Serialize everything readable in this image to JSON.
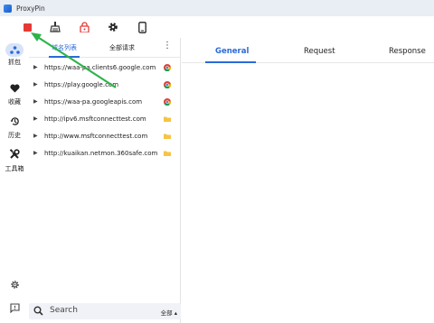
{
  "window": {
    "title": "ProxyPin"
  },
  "toolbar": {
    "buttons": [
      {
        "name": "stop",
        "icon": "stop-icon",
        "color": "#e53935"
      },
      {
        "name": "clear",
        "icon": "broom-icon"
      },
      {
        "name": "https-lock",
        "icon": "lock-icon",
        "color": "#e53935"
      },
      {
        "name": "settings",
        "icon": "gear-icon"
      },
      {
        "name": "mobile",
        "icon": "phone-icon"
      }
    ]
  },
  "rail": {
    "items": [
      {
        "label": "抓包",
        "icon": "capture-icon",
        "active": true
      },
      {
        "label": "收藏",
        "icon": "heart-icon"
      },
      {
        "label": "历史",
        "icon": "history-icon"
      },
      {
        "label": "工具箱",
        "icon": "tools-icon"
      }
    ],
    "bottom": [
      {
        "icon": "gear-icon"
      },
      {
        "icon": "feedback-icon"
      }
    ]
  },
  "list": {
    "tabs": [
      "域名列表",
      "全部请求"
    ],
    "active_tab": 0,
    "rows": [
      {
        "url": "https://waa-pa.clients6.google.com",
        "favicon": "chrome"
      },
      {
        "url": "https://play.google.com",
        "favicon": "chrome"
      },
      {
        "url": "https://waa-pa.googleapis.com",
        "favicon": "chrome"
      },
      {
        "url": "http://ipv6.msftconnecttest.com",
        "favicon": "folder"
      },
      {
        "url": "http://www.msftconnecttest.com",
        "favicon": "folder"
      },
      {
        "url": "http://kuaikan.netmon.360safe.com",
        "favicon": "folder"
      }
    ]
  },
  "search": {
    "placeholder": "Search",
    "scope": "全部"
  },
  "detail": {
    "tabs": [
      "General",
      "Request",
      "Response"
    ],
    "active_tab": 0
  },
  "colors": {
    "accent": "#2b6ad9",
    "annotation_arrow": "#2db34a"
  }
}
